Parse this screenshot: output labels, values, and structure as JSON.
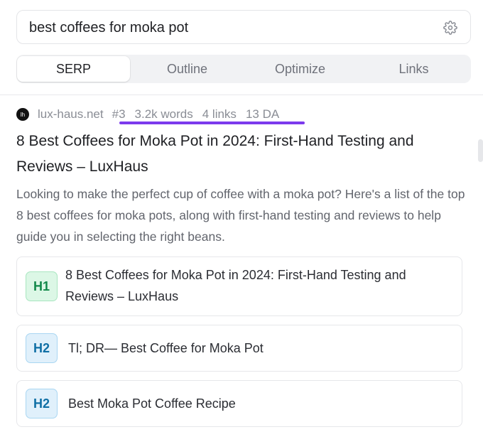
{
  "search": {
    "query": "best coffees for moka pot",
    "settings_icon": "gear-icon"
  },
  "tabs": [
    {
      "label": "SERP",
      "active": true
    },
    {
      "label": "Outline",
      "active": false
    },
    {
      "label": "Optimize",
      "active": false
    },
    {
      "label": "Links",
      "active": false
    }
  ],
  "result": {
    "favicon_text": "lh",
    "domain": "lux-haus.net",
    "rank": "#3",
    "words": "3.2k words",
    "links": "4 links",
    "da": "13 DA",
    "title": "8 Best Coffees for Moka Pot in 2024: First-Hand Testing and Reviews – LuxHaus",
    "description": "Looking to make the perfect cup of coffee with a moka pot? Here's a list of the top 8 best coffees for moka pots, along with first-hand testing and reviews to help guide you in selecting the right beans."
  },
  "headings": [
    {
      "tag": "H1",
      "text": "8 Best Coffees for Moka Pot in 2024: First-Hand Testing and Reviews – LuxHaus"
    },
    {
      "tag": "H2",
      "text": "Tl; DR— Best Coffee for Moka Pot"
    },
    {
      "tag": "H2",
      "text": "Best Moka Pot Coffee Recipe"
    }
  ],
  "colors": {
    "accent_underline": "#7c3aed",
    "h1_badge": "#12894a",
    "h2_badge": "#0f6fa5"
  }
}
